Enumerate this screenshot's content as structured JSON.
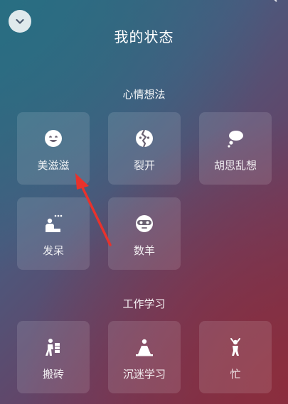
{
  "header": {
    "title": "我的状态",
    "collapse_icon": "chevron-down-icon"
  },
  "sections": [
    {
      "title": "心情想法",
      "items": [
        {
          "label": "美滋滋",
          "icon": "smile-icon"
        },
        {
          "label": "裂开",
          "icon": "cracked-face-icon"
        },
        {
          "label": "胡思乱想",
          "icon": "thought-bubble-icon"
        },
        {
          "label": "发呆",
          "icon": "daydream-person-icon"
        },
        {
          "label": "数羊",
          "icon": "sleep-mask-face-icon"
        }
      ]
    },
    {
      "title": "工作学习",
      "items": [
        {
          "label": "搬砖",
          "icon": "carrying-bricks-icon"
        },
        {
          "label": "沉迷学习",
          "icon": "studying-person-icon"
        },
        {
          "label": "忙",
          "icon": "busy-person-icon"
        }
      ]
    }
  ],
  "annotation": {
    "color": "#e8322c"
  }
}
